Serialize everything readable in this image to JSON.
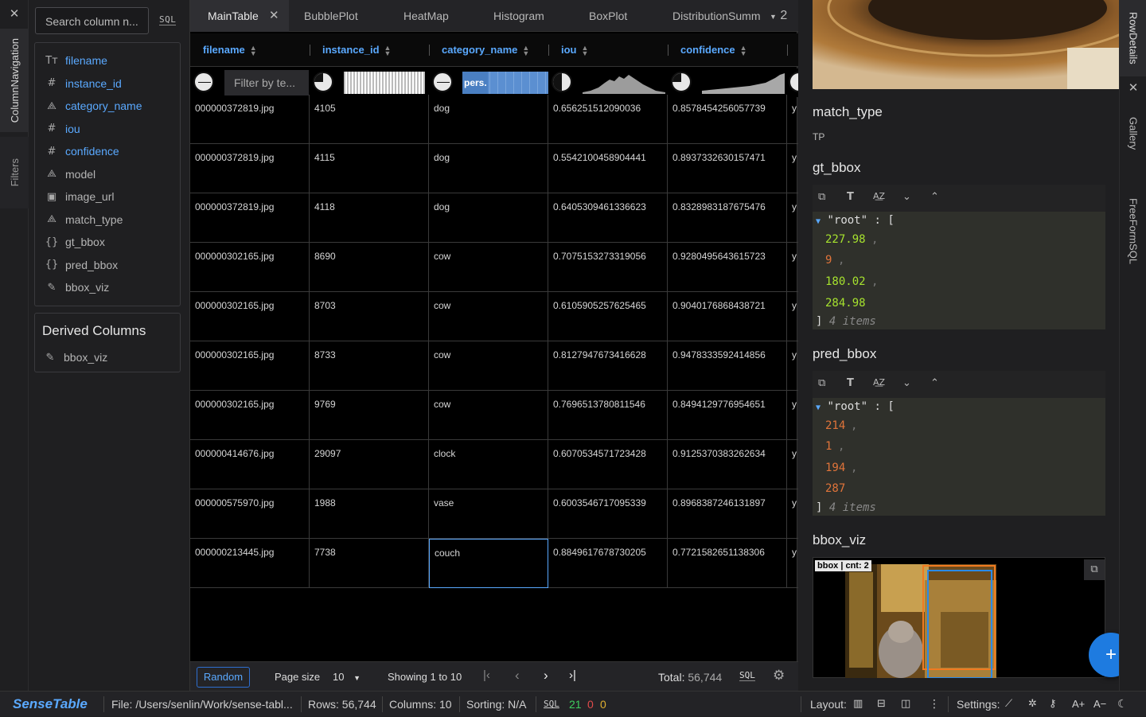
{
  "left_rail": {
    "tab1": "ColumnNavigation",
    "tab2": "Filters",
    "close": "✕"
  },
  "colnav": {
    "search_placeholder": "Search column n...",
    "sql_label": "SQL",
    "columns": [
      {
        "name": "filename",
        "icon": "text-type-icon",
        "glyph": "Tт",
        "selected": true
      },
      {
        "name": "instance_id",
        "icon": "hash-icon",
        "glyph": "#",
        "selected": true
      },
      {
        "name": "category_name",
        "icon": "shapes-icon",
        "glyph": "⟁",
        "selected": true
      },
      {
        "name": "iou",
        "icon": "hash-icon",
        "glyph": "#",
        "selected": true
      },
      {
        "name": "confidence",
        "icon": "hash-icon",
        "glyph": "#",
        "selected": true
      },
      {
        "name": "model",
        "icon": "shapes-icon",
        "glyph": "⟁",
        "selected": false
      },
      {
        "name": "image_url",
        "icon": "image-icon",
        "glyph": "▣",
        "selected": false
      },
      {
        "name": "match_type",
        "icon": "shapes-icon",
        "glyph": "⟁",
        "selected": false
      },
      {
        "name": "gt_bbox",
        "icon": "braces-icon",
        "glyph": "{}",
        "selected": false
      },
      {
        "name": "pred_bbox",
        "icon": "braces-icon",
        "glyph": "{}",
        "selected": false
      },
      {
        "name": "bbox_viz",
        "icon": "brush-icon",
        "glyph": "✎",
        "selected": false
      }
    ],
    "derived_title": "Derived Columns",
    "derived": [
      {
        "name": "bbox_viz",
        "icon": "brush-icon",
        "glyph": "✎"
      }
    ]
  },
  "tabs": {
    "items": [
      "MainTable",
      "BubblePlot",
      "HeatMap",
      "Histogram",
      "BoxPlot",
      "DistributionSumm"
    ],
    "overflow_count": "2",
    "close": "✕"
  },
  "table": {
    "headers": [
      "filename",
      "instance_id",
      "category_name",
      "iou",
      "confidence"
    ],
    "filter_placeholder": "Filter by te...",
    "category_chip": "pers.",
    "rows": [
      [
        "000000372819.jpg",
        "4105",
        "dog",
        "0.656251512090036",
        "0.8578454256057739",
        "y"
      ],
      [
        "000000372819.jpg",
        "4115",
        "dog",
        "0.5542100458904441",
        "0.8937332630157471",
        "y"
      ],
      [
        "000000372819.jpg",
        "4118",
        "dog",
        "0.6405309461336623",
        "0.8328983187675476",
        "y"
      ],
      [
        "000000302165.jpg",
        "8690",
        "cow",
        "0.7075153273319056",
        "0.9280495643615723",
        "y"
      ],
      [
        "000000302165.jpg",
        "8703",
        "cow",
        "0.6105905257625465",
        "0.9040176868438721",
        "y"
      ],
      [
        "000000302165.jpg",
        "8733",
        "cow",
        "0.8127947673416628",
        "0.9478333592414856",
        "y"
      ],
      [
        "000000302165.jpg",
        "9769",
        "cow",
        "0.7696513780811546",
        "0.8494129776954651",
        "y"
      ],
      [
        "000000414676.jpg",
        "29097",
        "clock",
        "0.6070534571723428",
        "0.9125370383262634",
        "y"
      ],
      [
        "000000575970.jpg",
        "1988",
        "vase",
        "0.6003546717095339",
        "0.8968387246131897",
        "y"
      ],
      [
        "000000213445.jpg",
        "7738",
        "couch",
        "0.8849617678730205",
        "0.7721582651138306",
        "y"
      ]
    ]
  },
  "pager": {
    "random": "Random",
    "page_size_label": "Page size",
    "page_size": "10",
    "showing": "Showing 1 to 10",
    "total_label": "Total:",
    "total": "56,744",
    "sql": "SQL"
  },
  "details": {
    "match_type_title": "match_type",
    "match_type_value": "TP",
    "gt_title": "gt_bbox",
    "gt_values": [
      "227.98",
      "9",
      "180.02",
      "284.98"
    ],
    "pred_title": "pred_bbox",
    "pred_values": [
      "214",
      "1",
      "194",
      "287"
    ],
    "root_key": "\"root\"",
    "items_label": "4 items",
    "viz_title": "bbox_viz",
    "viz_badge": "bbox | cnt: 2",
    "tabs": [
      "RowDetails",
      "Gallery",
      "FreeFormSQL"
    ]
  },
  "status": {
    "brand": "SenseTable",
    "file": "File: /Users/senlin/Work/sense-tabl...",
    "rows": "Rows: 56,744",
    "columns": "Columns: 10",
    "sorting": "Sorting: N/A",
    "sql": "SQL",
    "count_green": "21",
    "count_red": "0",
    "count_yellow": "0",
    "layout": "Layout:",
    "settings": "Settings:"
  },
  "colors": {
    "accent": "#5aa9ff",
    "fab": "#1e7be0",
    "green": "#3ecf5e",
    "red": "#e04b4b",
    "yellow": "#e0b030"
  }
}
